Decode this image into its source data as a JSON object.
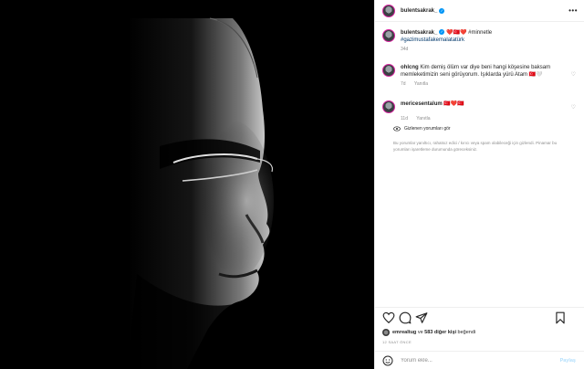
{
  "post": {
    "author": "bulentsakrak_",
    "image_alt_icon": "portrait-photo"
  },
  "header": {
    "username": "bulentsakrak_",
    "more_icon": "more-dots-icon"
  },
  "caption": {
    "username": "bulentsakrak_",
    "text": "❤️🇹🇷❤️ #minnetle",
    "hashtag": "#gazimustafakemalatatürk",
    "time": "34d"
  },
  "comments": [
    {
      "username": "ohlcng",
      "text": "Kim demiş ölüm var diye beni hangi köşesine baksam memleketimizin seni görüyorum. Işıklarda yürü Atam 🇹🇷🤍",
      "time": "7d",
      "reply_label": "Yanıtla"
    },
    {
      "username": "mericesentalum",
      "text": "🇹🇷❤️🇹🇷",
      "time": "11d",
      "reply_label": "Yanıtla"
    }
  ],
  "hidden_comments": {
    "link_label": "Gizlenen yorumları gör",
    "description": "Bu yorumlar yanıltıcı, rahatsız edici / kırıcı veya spam olabileceği için gizlendi. Pinamar bu yorumları işaretleme durumunda göreceksiniz."
  },
  "actions": {
    "like_icon": "heart-icon",
    "comment_icon": "comment-icon",
    "share_icon": "send-icon",
    "save_icon": "bookmark-icon"
  },
  "likes": {
    "first_user": "emrealtug",
    "connector": " ve ",
    "others": "583 diğer kişi",
    "suffix": " beğendi"
  },
  "date_label": "12 SAAT ÖNCE",
  "add_comment": {
    "placeholder": "Yorum ekle...",
    "post_label": "Paylaş",
    "emoji_icon": "emoji-icon"
  },
  "colors": {
    "link_blue": "#00376b",
    "post_button": "#b2dffc",
    "verified": "#0095f6"
  }
}
